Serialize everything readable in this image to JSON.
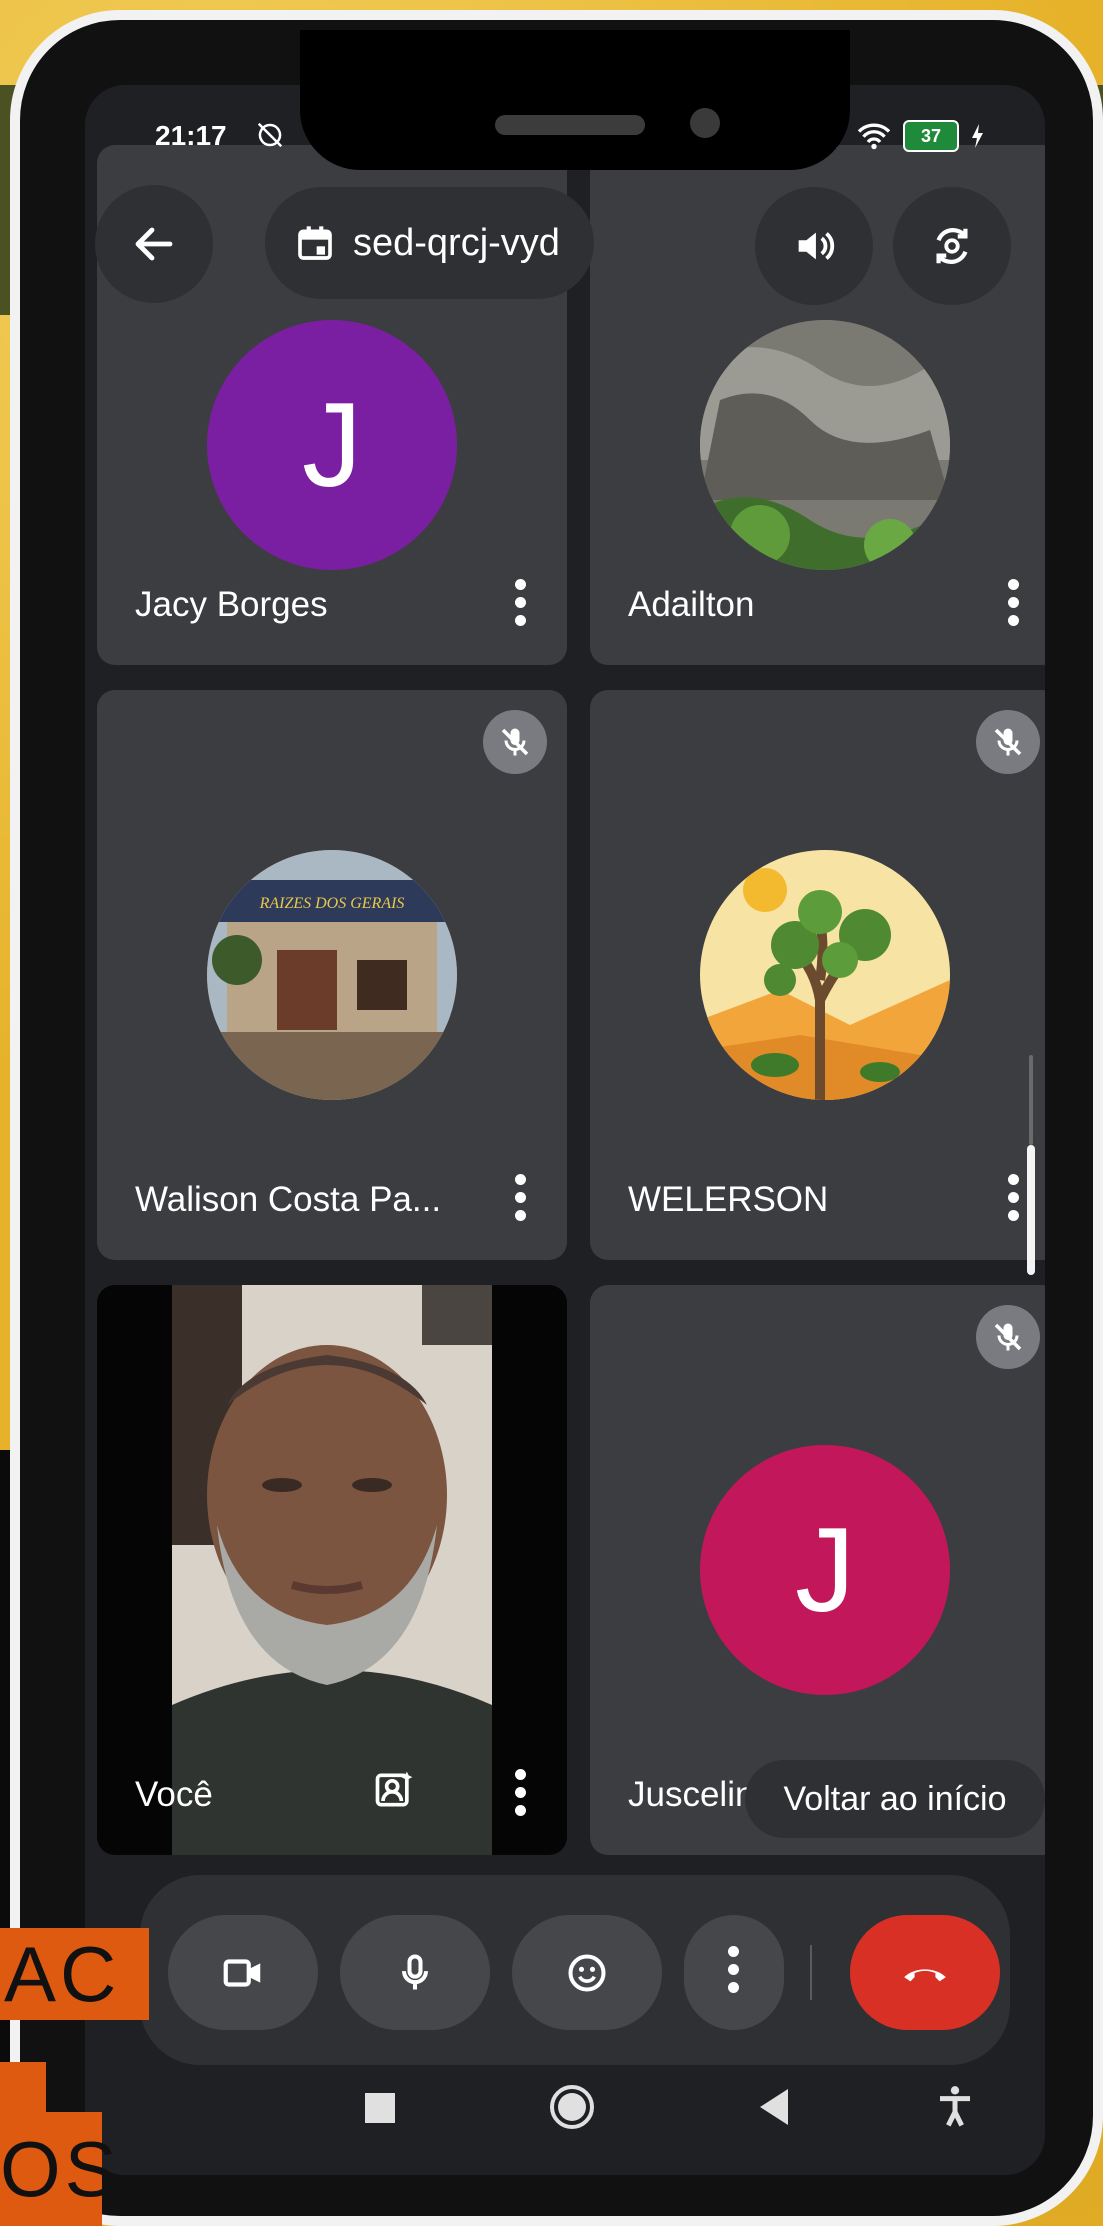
{
  "status_bar": {
    "time": "21:17",
    "battery": "37"
  },
  "header": {
    "meeting_code": "sed-qrcj-vyd"
  },
  "participants": [
    {
      "name": "Jacy Borges",
      "avatar_letter": "J",
      "avatar_color": "#7b1fa2",
      "muted": false
    },
    {
      "name": "Adailton",
      "avatar_type": "photo-rocks",
      "muted": false
    },
    {
      "name": "Walison Costa Pa...",
      "avatar_type": "photo-storefront",
      "storefront_sign": "RAIZES DOS GERAIS",
      "muted": true
    },
    {
      "name": "WELERSON",
      "avatar_type": "illustration-joshua-tree",
      "muted": true
    },
    {
      "name": "Você",
      "avatar_type": "self-video",
      "muted": false
    },
    {
      "name": "Juscelino",
      "avatar_letter": "J",
      "avatar_color": "#c2185b",
      "muted": true
    }
  ],
  "toast": {
    "text": "Voltar ao início"
  },
  "controls": [
    "camera-icon",
    "mic-icon",
    "emoji-icon",
    "more-icon",
    "end-call-icon"
  ],
  "overlay_text": {
    "line1": "AC",
    "line2": "OS"
  },
  "colors": {
    "background": "#1f2023",
    "tile": "#3c3d41",
    "end_call": "#d93025",
    "overlay": "#dd5a10"
  }
}
